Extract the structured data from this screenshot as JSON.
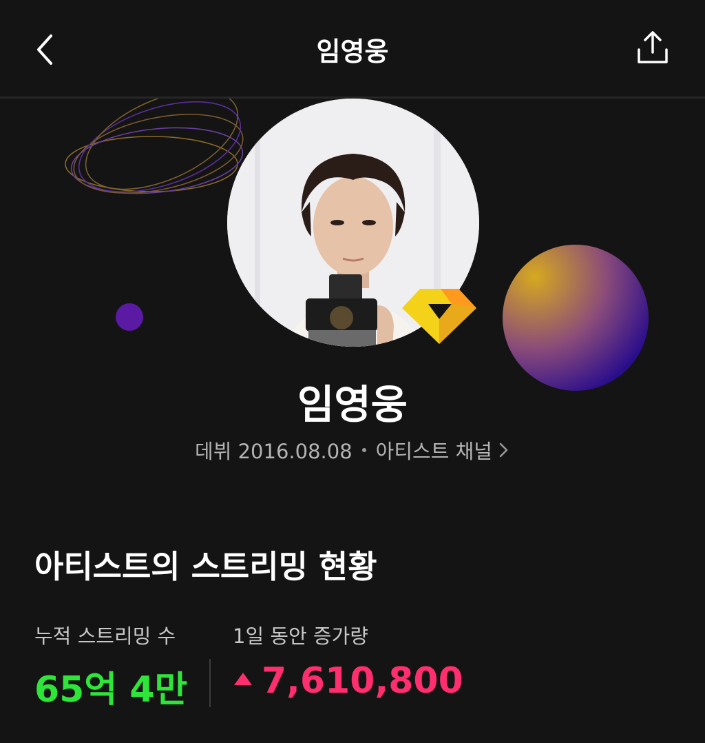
{
  "header": {
    "title": "임영웅",
    "back_icon": "chevron-left-icon",
    "share_icon": "share-icon"
  },
  "profile": {
    "name": "임영웅",
    "debut": "데뷔 2016.08.08",
    "channel_link": "아티스트 채널",
    "badge_icon": "diamond-badge-icon"
  },
  "streaming": {
    "section_title": "아티스트의 스트리밍 현황",
    "total_label": "누적 스트리밍 수",
    "total_value": "65억 4만",
    "daily_label": "1일 동안 증가량",
    "daily_value": "7,610,800"
  },
  "colors": {
    "background": "#141414",
    "total_value": "#2ee63a",
    "daily_value": "#ff2e6f",
    "badge_yellow": "#f4d21a",
    "badge_orange": "#ff9a1f"
  }
}
